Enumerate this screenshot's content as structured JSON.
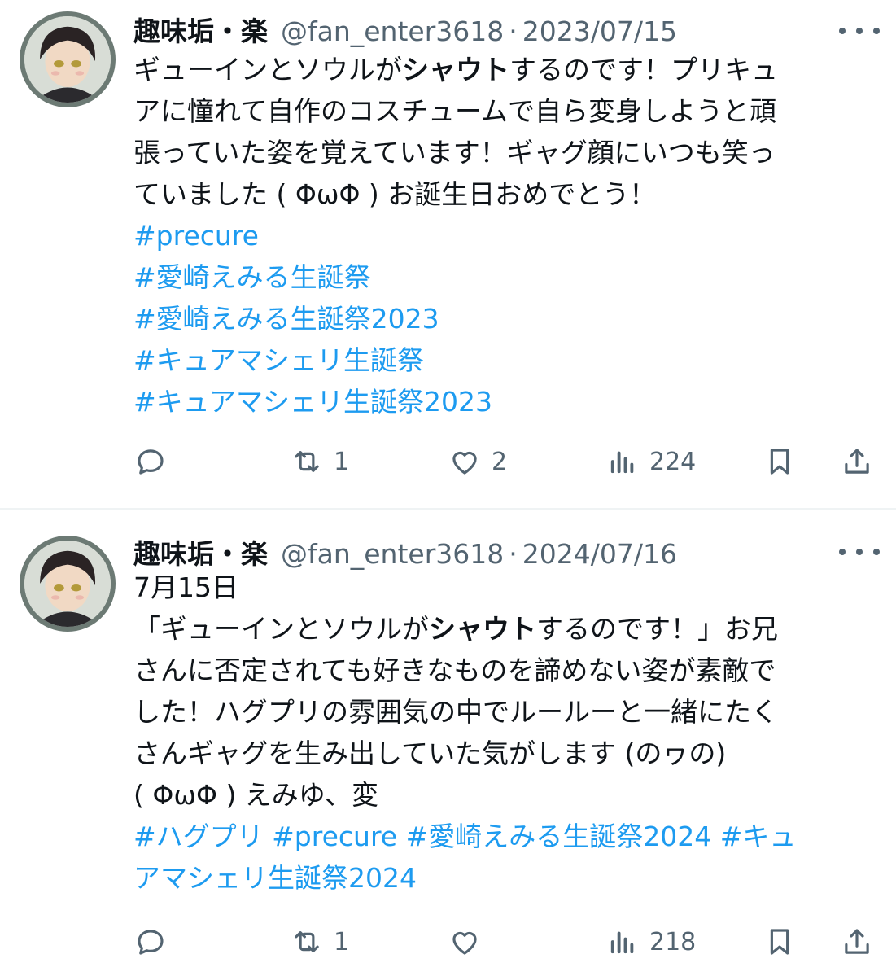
{
  "tweets": [
    {
      "name": "趣味垢・楽",
      "handle": "@fan_enter3618",
      "separator": "·",
      "date": "2023/07/15",
      "text_lines": [
        [
          "ギューインとソウルが",
          "シャウト",
          "するのです！プリキュ"
        ],
        "アに憧れて自作のコスチュームで自ら変身しようと頑",
        "張っていた姿を覚えています！ギャグ顔にいつも笑っ",
        "ていました ( ΦωΦ ) お誕生日おめでとう！"
      ],
      "hashtags": [
        "#precure",
        "#愛崎えみる生誕祭",
        "#愛崎えみる生誕祭2023",
        "#キュアマシェリ生誕祭",
        "#キュアマシェリ生誕祭2023"
      ],
      "stats": {
        "replies": "",
        "retweets": "1",
        "likes": "2",
        "views": "224"
      }
    },
    {
      "name": "趣味垢・楽",
      "handle": "@fan_enter3618",
      "separator": "·",
      "date": "2024/07/16",
      "line1": "7月15日",
      "line2_pre": "「ギューインとソウルが",
      "line2_bold": "シャウト",
      "line2_post": "するのです！」お兄",
      "line3": "さんに否定されても好きなものを諦めない姿が素敵で",
      "line4": "した！ハグプリの雰囲気の中でルールーと一緒にたく",
      "line5": "さんギャグを生み出していた気がします (のヮの)",
      "line6": "( ΦωΦ ) えみゆ、変",
      "tag_line1": "#ハグプリ #precure #愛崎えみる生誕祭2024 #キュ",
      "tag_line2": "アマシェリ生誕祭2024",
      "stats": {
        "replies": "",
        "retweets": "1",
        "likes": "",
        "views": "218"
      }
    }
  ],
  "icons": [
    "reply-icon",
    "retweet-icon",
    "like-icon",
    "views-icon",
    "bookmark-icon",
    "share-icon",
    "more-icon",
    "avatar"
  ],
  "colors": {
    "link": "#1d9bf0",
    "secondary_text": "#536471",
    "text": "#0f1419"
  }
}
